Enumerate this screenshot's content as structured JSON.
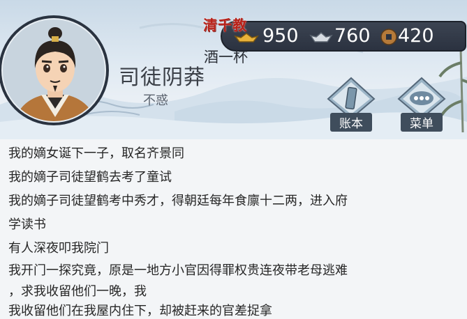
{
  "character": {
    "name": "司徒阴莽",
    "age_title": "不惑"
  },
  "brand": {
    "title": "清千教",
    "subtitle": "酒一杯"
  },
  "resources": [
    {
      "icon": "gold-ingot-icon",
      "value": "950"
    },
    {
      "icon": "silver-ingot-icon",
      "value": "760"
    },
    {
      "icon": "copper-coin-icon",
      "value": "420"
    }
  ],
  "menu": {
    "ledger_label": "账本",
    "menu_label": "菜单"
  },
  "log": [
    "我的嫡女诞下一子，取名齐景同",
    "我的嫡子司徒望鹤去考了童试",
    "我的嫡子司徒望鹤考中秀才，得朝廷每年食廪十二两，进入府",
    "学读书",
    "有人深夜叩我院门",
    "我开门一探究竟，原是一地方小官因得罪权贵连夜带老母逃难",
    "，求我收留他们一晚，我",
    "我收留他们在我屋内住下，却被赶来的官差捉拿"
  ]
}
